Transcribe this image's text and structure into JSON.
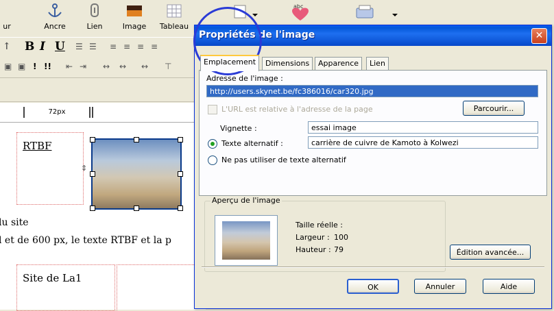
{
  "toolbar": {
    "buttons": [
      {
        "label": "ur"
      },
      {
        "label": "Ancre"
      },
      {
        "label": "Lien"
      },
      {
        "label": "Image"
      },
      {
        "label": "Tableau"
      }
    ],
    "bold": "B",
    "italic": "I",
    "underline": "U"
  },
  "editor": {
    "ruler_value": "72px",
    "cell_rtbf": "RTBF",
    "para1": "lu site",
    "para2": "l et de 600 px, le texte RTBF et la p",
    "cell_site": "Site de La1"
  },
  "dialog": {
    "title": "Propriétés de l'image",
    "close": "✕",
    "tabs": [
      "Emplacement",
      "Dimensions",
      "Apparence",
      "Lien"
    ],
    "image_address_label": "Adresse de l'image :",
    "image_address_value": "http://users.skynet.be/fc386016/car320.jpg",
    "relative_url_label": "L'URL est relative à l'adresse de la page",
    "browse_button": "Parcourir...",
    "tooltip_label": "Vignette :",
    "tooltip_value": "essai image",
    "alt_text_label": "Texte alternatif :",
    "alt_text_value": "carrière de cuivre de Kamoto à Kolwezi",
    "no_alt_label": "Ne pas utiliser de texte alternatif",
    "preview_legend": "Aperçu de l'image",
    "actual_size_label": "Taille réelle :",
    "width_label": "Largeur :",
    "width_value": "100",
    "height_label": "Hauteur :",
    "height_value": "79",
    "advanced_button": "Édition avancée...",
    "ok_button": "OK",
    "cancel_button": "Annuler",
    "help_button": "Aide"
  },
  "colors": {
    "titlebar": "#0458d8",
    "selection": "#316ac5",
    "annotation_circle": "#2a3bd6",
    "active_tab_accent": "#ffc83c"
  }
}
